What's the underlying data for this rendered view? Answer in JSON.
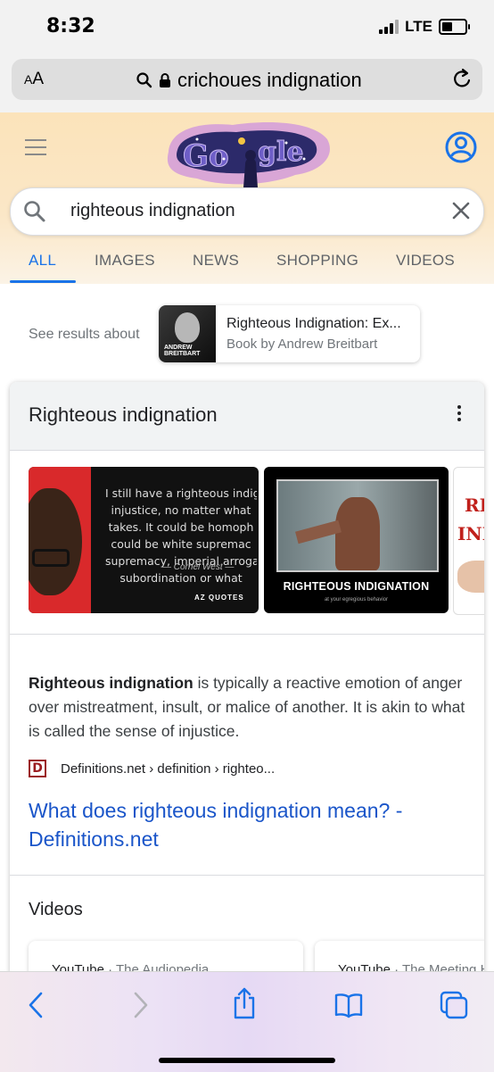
{
  "status_bar": {
    "time": "8:32",
    "network": "LTE",
    "battery_level": 0.45
  },
  "browser": {
    "text_size_button": "AA",
    "url": "crichoues indignation",
    "toolbar": {
      "back": "back-icon",
      "forward": "forward-icon",
      "share": "share-icon",
      "bookmarks": "book-icon",
      "tabs": "tabs-icon"
    }
  },
  "google": {
    "search_query": "righteous indignation",
    "tabs": [
      {
        "label": "ALL",
        "active": true
      },
      {
        "label": "IMAGES",
        "active": false
      },
      {
        "label": "NEWS",
        "active": false
      },
      {
        "label": "SHOPPING",
        "active": false
      },
      {
        "label": "VIDEOS",
        "active": false
      }
    ],
    "doodle_text": "Google"
  },
  "see_results": {
    "label": "See results about",
    "card": {
      "title": "Righteous Indignation: Ex...",
      "subtitle": "Book by Andrew Breitbart",
      "thumb_text": "ANDREW BREITBART"
    }
  },
  "knowledge_panel": {
    "title": "Righteous indignation",
    "images": [
      {
        "quote_lines": [
          "I still have a righteous indig",
          "injustice, no matter what",
          "takes. It could be homoph",
          "could be white supremac",
          "supremacy, imperial arroga",
          "subordination or what"
        ],
        "signature": "— Cornel West —",
        "watermark": "AZ QUOTES"
      },
      {
        "caption": "RIGHTEOUS INDIGNATION",
        "subcaption": "at your egregious behavior"
      },
      {
        "line1": "RI",
        "line2": "IND"
      }
    ],
    "description_bold": "Righteous indignation",
    "description_rest": " is typically a reactive emotion of anger over mistreatment, insult, or malice of another. It is akin to what is called the sense of injustice.",
    "source": {
      "logo": "D",
      "breadcrumb": "Definitions.net › definition › righteo..."
    },
    "link": "What does righteous indignation mean? - Definitions.net",
    "videos_heading": "Videos",
    "video_cards": [
      {
        "source": "YouTube",
        "channel": "· The Audiopedia"
      },
      {
        "source": "YouTube",
        "channel": "· The Meeting H"
      }
    ]
  }
}
